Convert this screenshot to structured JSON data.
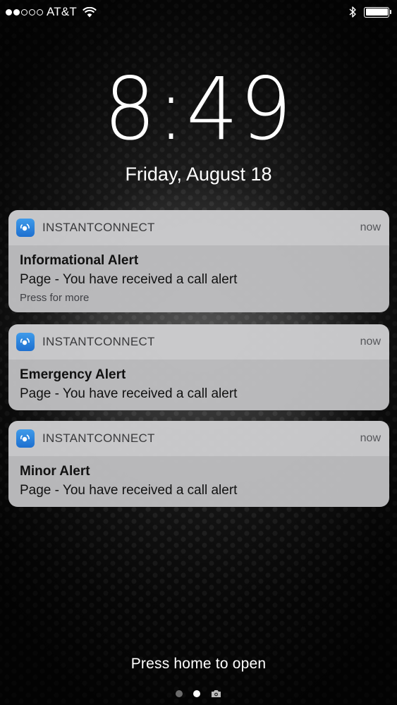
{
  "status_bar": {
    "carrier": "AT&T",
    "signal_bars_filled": 2,
    "signal_bars_total": 5,
    "wifi_icon": "wifi-icon",
    "bluetooth_icon": "bluetooth-icon",
    "battery_level": 1.0
  },
  "lock_screen": {
    "time": "8:49",
    "date": "Friday, August 18"
  },
  "notifications": [
    {
      "app_name": "INSTANTCONNECT",
      "time": "now",
      "title": "Informational Alert",
      "message": "Page - You have received a call alert",
      "hint": "Press for more"
    },
    {
      "app_name": "INSTANTCONNECT",
      "time": "now",
      "title": "Emergency Alert",
      "message": "Page - You have received a call alert"
    },
    {
      "app_name": "INSTANTCONNECT",
      "time": "now",
      "title": "Minor Alert",
      "message": "Page - You have received a call alert"
    }
  ],
  "footer": {
    "press_home": "Press home to open",
    "page_indicator_active_index": 1,
    "camera_icon": "camera-icon"
  },
  "colors": {
    "app_icon": "#2f86e0",
    "notification_header": "#cecece",
    "notification_body": "#bebec1"
  }
}
